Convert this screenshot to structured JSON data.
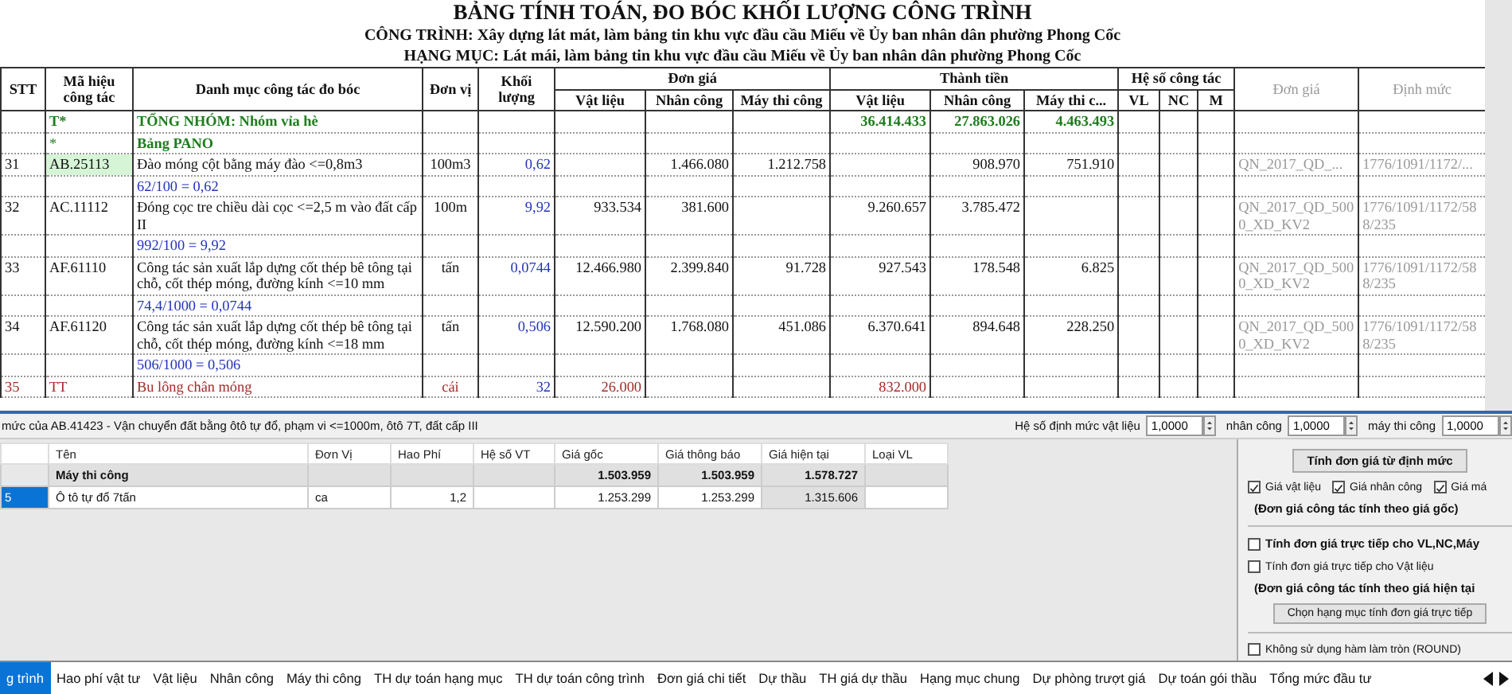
{
  "sheet": {
    "title": "BẢNG TÍNH TOÁN, ĐO BÓC KHỐI LƯỢNG CÔNG TRÌNH",
    "project": "CÔNG TRÌNH: Xây dựng lát mát, làm bảng tin khu vực đầu cầu Miếu về Ủy ban nhân dân phường Phong Cốc",
    "category": "HẠNG MỤC: Lát mái, làm bảng tin khu vực đầu cầu Miếu về Ủy ban nhân dân phường Phong Cốc",
    "header": {
      "stt": "STT",
      "code": "Mã hiệu công tác",
      "name": "Danh mục công tác đo bóc",
      "unit": "Đơn vị",
      "qty": "Khối lượng",
      "unit_price": "Đơn giá",
      "total": "Thành tiền",
      "coef": "Hệ số công tác",
      "norm_price": "Đơn giá",
      "norm_ref": "Định mức",
      "unit_price_parts": [
        "Vật liệu",
        "Nhân công",
        "Máy thi công"
      ],
      "total_parts": [
        "Vật liệu",
        "Nhân công",
        "Máy thi c..."
      ],
      "coef_parts": [
        "VL",
        "NC",
        "M"
      ]
    },
    "rows": [
      {
        "kind": "group",
        "selected": false,
        "code": "T*",
        "name": "TỔNG NHÓM: Nhóm vỉa hè",
        "tvl": "36.414.433",
        "tnc": "27.863.026",
        "tm": "4.463.493"
      },
      {
        "kind": "section",
        "selected": false,
        "code": "*",
        "name": "Bảng PANO"
      },
      {
        "kind": "item",
        "selected": true,
        "stt": "31",
        "code": "AB.25113",
        "name": "Đào móng cột bằng máy đào <=0,8m3",
        "unit": "100m3",
        "qty": "0,62",
        "nc": "1.466.080",
        "m": "1.212.758",
        "tnc": "908.970",
        "tm": "751.910",
        "dg": "QN_2017_QD_...",
        "dm": "1776/1091/1172/..."
      },
      {
        "kind": "formula",
        "selected": false,
        "name": "62/100 = 0,62"
      },
      {
        "kind": "item",
        "selected": false,
        "stt": "32",
        "code": "AC.11112",
        "name": "Đóng cọc tre chiều dài cọc <=2,5 m vào đất cấp II",
        "unit": "100m",
        "qty": "9,92",
        "vl": "933.534",
        "nc": "381.600",
        "tvl": "9.260.657",
        "tnc": "3.785.472",
        "dg": "QN_2017_QD_5000_XD_KV2",
        "dm": "1776/1091/1172/588/235"
      },
      {
        "kind": "formula",
        "selected": false,
        "name": "992/100 = 9,92"
      },
      {
        "kind": "item",
        "selected": false,
        "stt": "33",
        "code": "AF.61110",
        "name": "Công tác sản xuất lắp dựng cốt thép bê tông tại chỗ, cốt thép móng, đường kính <=10 mm",
        "unit": "tấn",
        "qty": "0,0744",
        "vl": "12.466.980",
        "nc": "2.399.840",
        "m": "91.728",
        "tvl": "927.543",
        "tnc": "178.548",
        "tm": "6.825",
        "dg": "QN_2017_QD_5000_XD_KV2",
        "dm": "1776/1091/1172/588/235"
      },
      {
        "kind": "formula",
        "selected": false,
        "name": "74,4/1000 = 0,0744"
      },
      {
        "kind": "item",
        "selected": false,
        "stt": "34",
        "code": "AF.61120",
        "name": "Công tác sản xuất lắp dựng cốt thép bê tông tại chỗ, cốt thép móng, đường kính <=18 mm",
        "unit": "tấn",
        "qty": "0,506",
        "vl": "12.590.200",
        "nc": "1.768.080",
        "m": "451.086",
        "tvl": "6.370.641",
        "tnc": "894.648",
        "tm": "228.250",
        "dg": "QN_2017_QD_5000_XD_KV2",
        "dm": "1776/1091/1172/588/235"
      },
      {
        "kind": "formula",
        "selected": false,
        "name": "506/1000 = 0,506"
      },
      {
        "kind": "extra",
        "selected": false,
        "stt": "35",
        "code": "TT",
        "name": "Bu lông chân móng",
        "unit": "cái",
        "qty": "32",
        "vl": "26.000",
        "tvl": "832.000"
      }
    ]
  },
  "detail": {
    "caption": "mức của AB.41423 - Vận chuyển đất bằng ôtô tự đổ, phạm vi <=1000m, ôtô 7T, đất cấp III",
    "coef_fields": [
      {
        "label": "Hệ số định mức vật liệu",
        "value": "1,0000"
      },
      {
        "label": "nhân công",
        "value": "1,0000"
      },
      {
        "label": "máy thi công",
        "value": "1,0000"
      }
    ],
    "columns": [
      "Tên",
      "Đơn Vị",
      "Hao Phí",
      "Hệ số VT",
      "Giá gốc",
      "Giá thông báo",
      "Giá hiện tại",
      "Loại VL"
    ],
    "rows": [
      {
        "kind": "group",
        "selected": false,
        "cells": [
          "Máy thi công",
          "",
          "",
          "",
          "1.503.959",
          "1.503.959",
          "1.578.727",
          ""
        ]
      },
      {
        "kind": "item",
        "selected": true,
        "row_header": "5",
        "cells": [
          "Ô tô tự đổ 7tấn",
          "ca",
          "1,2",
          "",
          "1.253.299",
          "1.253.299",
          "1.315.606",
          ""
        ]
      }
    ]
  },
  "panel": {
    "calc_button": "Tính đơn giá từ định mức",
    "price_checks": [
      {
        "label": "Giá vật liệu",
        "checked": true
      },
      {
        "label": "Giá nhân công",
        "checked": true
      },
      {
        "label": "Giá má",
        "checked": true
      }
    ],
    "base_note": "(Đơn giá công tác tính theo giá gốc)",
    "direct_all": {
      "label": "Tính đơn giá trực tiếp cho VL,NC,Máy",
      "checked": false
    },
    "direct_material": {
      "label": "Tính đơn giá trực tiếp cho Vật liệu",
      "checked": false
    },
    "current_note": "(Đơn giá công tác tính theo giá hiện tại",
    "choose_button": "Chọn hạng mục tính đơn giá trực tiếp",
    "no_round": {
      "label": "Không sử dụng hàm làm tròn (ROUND)",
      "checked": false
    }
  },
  "tabs": [
    {
      "label": "g trình",
      "selected": true
    },
    {
      "label": "Hao phí vật tư",
      "selected": false
    },
    {
      "label": "Vật liệu",
      "selected": false
    },
    {
      "label": "Nhân công",
      "selected": false
    },
    {
      "label": "Máy thi công",
      "selected": false
    },
    {
      "label": "TH dự toán hạng mục",
      "selected": false
    },
    {
      "label": "TH dự toán công trình",
      "selected": false
    },
    {
      "label": "Đơn giá chi tiết",
      "selected": false
    },
    {
      "label": "Dự thầu",
      "selected": false
    },
    {
      "label": "TH giá dự thầu",
      "selected": false
    },
    {
      "label": "Hạng mục chung",
      "selected": false
    },
    {
      "label": "Dự phòng trượt giá",
      "selected": false
    },
    {
      "label": "Dự toán gói thầu",
      "selected": false
    },
    {
      "label": "Tổng mức đầu tư",
      "selected": false
    }
  ]
}
